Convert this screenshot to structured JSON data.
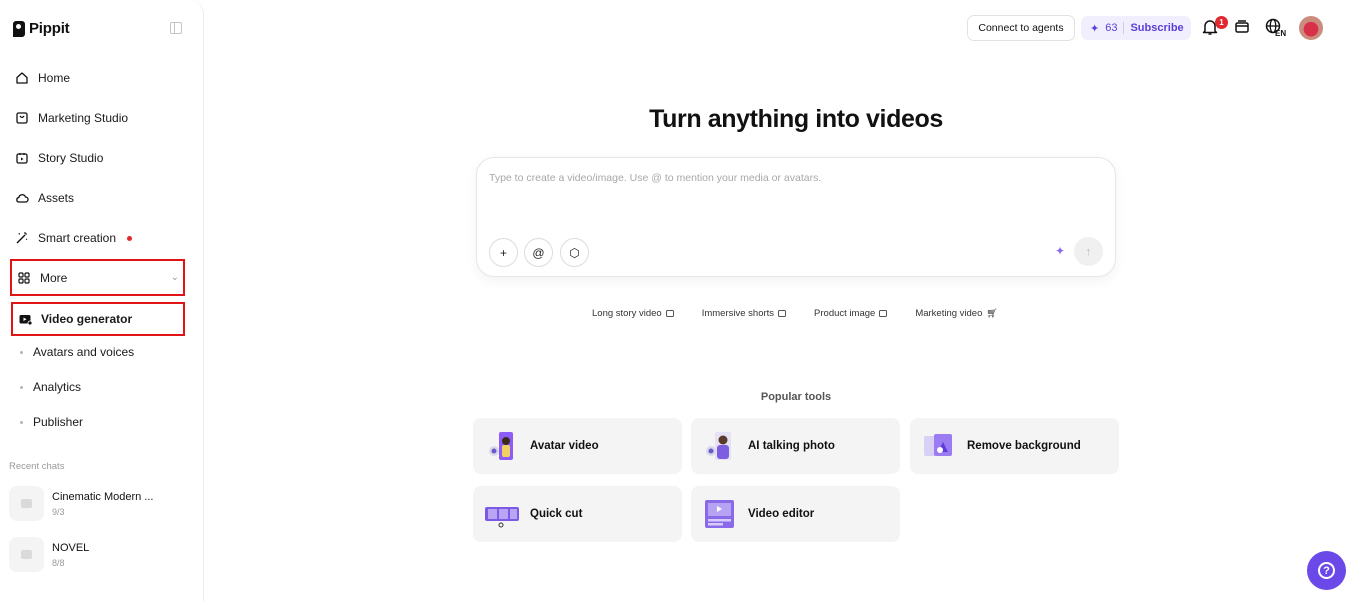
{
  "brand": {
    "name": "Pippit"
  },
  "sidebar": {
    "nav": [
      {
        "label": "Home",
        "icon": "home-icon"
      },
      {
        "label": "Marketing Studio",
        "icon": "bag-icon"
      },
      {
        "label": "Story Studio",
        "icon": "story-icon"
      },
      {
        "label": "Assets",
        "icon": "cloud-icon"
      },
      {
        "label": "Smart creation",
        "icon": "magic-wand-icon"
      }
    ],
    "more_label": "More",
    "active_item": "Video generator",
    "sub_items": [
      "Avatars and voices",
      "Analytics",
      "Publisher"
    ],
    "recent_label": "Recent chats",
    "recent_chats": [
      {
        "title": "Cinematic Modern ...",
        "meta": "9/3"
      },
      {
        "title": "NOVEL",
        "meta": "8/8"
      }
    ]
  },
  "topbar": {
    "agents_button": "Connect to agents",
    "credits": "63",
    "subscribe": "Subscribe",
    "notification_count": "1",
    "language": "EN"
  },
  "main": {
    "headline": "Turn anything into videos",
    "prompt_placeholder": "Type to create a video/image. Use @ to mention your media or avatars.",
    "prompt_buttons": {
      "add": "+",
      "mention": "@",
      "model": "⬡"
    },
    "chips": [
      {
        "label": "Long story video"
      },
      {
        "label": "Immersive shorts"
      },
      {
        "label": "Product image"
      },
      {
        "label": "Marketing video"
      }
    ],
    "popular_label": "Popular tools",
    "tools": [
      {
        "label": "Avatar video",
        "color": "#8b5cf6"
      },
      {
        "label": "AI talking photo",
        "color": "#7c5fe0"
      },
      {
        "label": "Remove background",
        "color": "#9b7cf2"
      },
      {
        "label": "Quick cut",
        "color": "#7b5ae6"
      },
      {
        "label": "Video editor",
        "color": "#8a6ae8"
      }
    ]
  },
  "colors": {
    "accent": "#6b48e8",
    "highlight": "#e01414"
  }
}
